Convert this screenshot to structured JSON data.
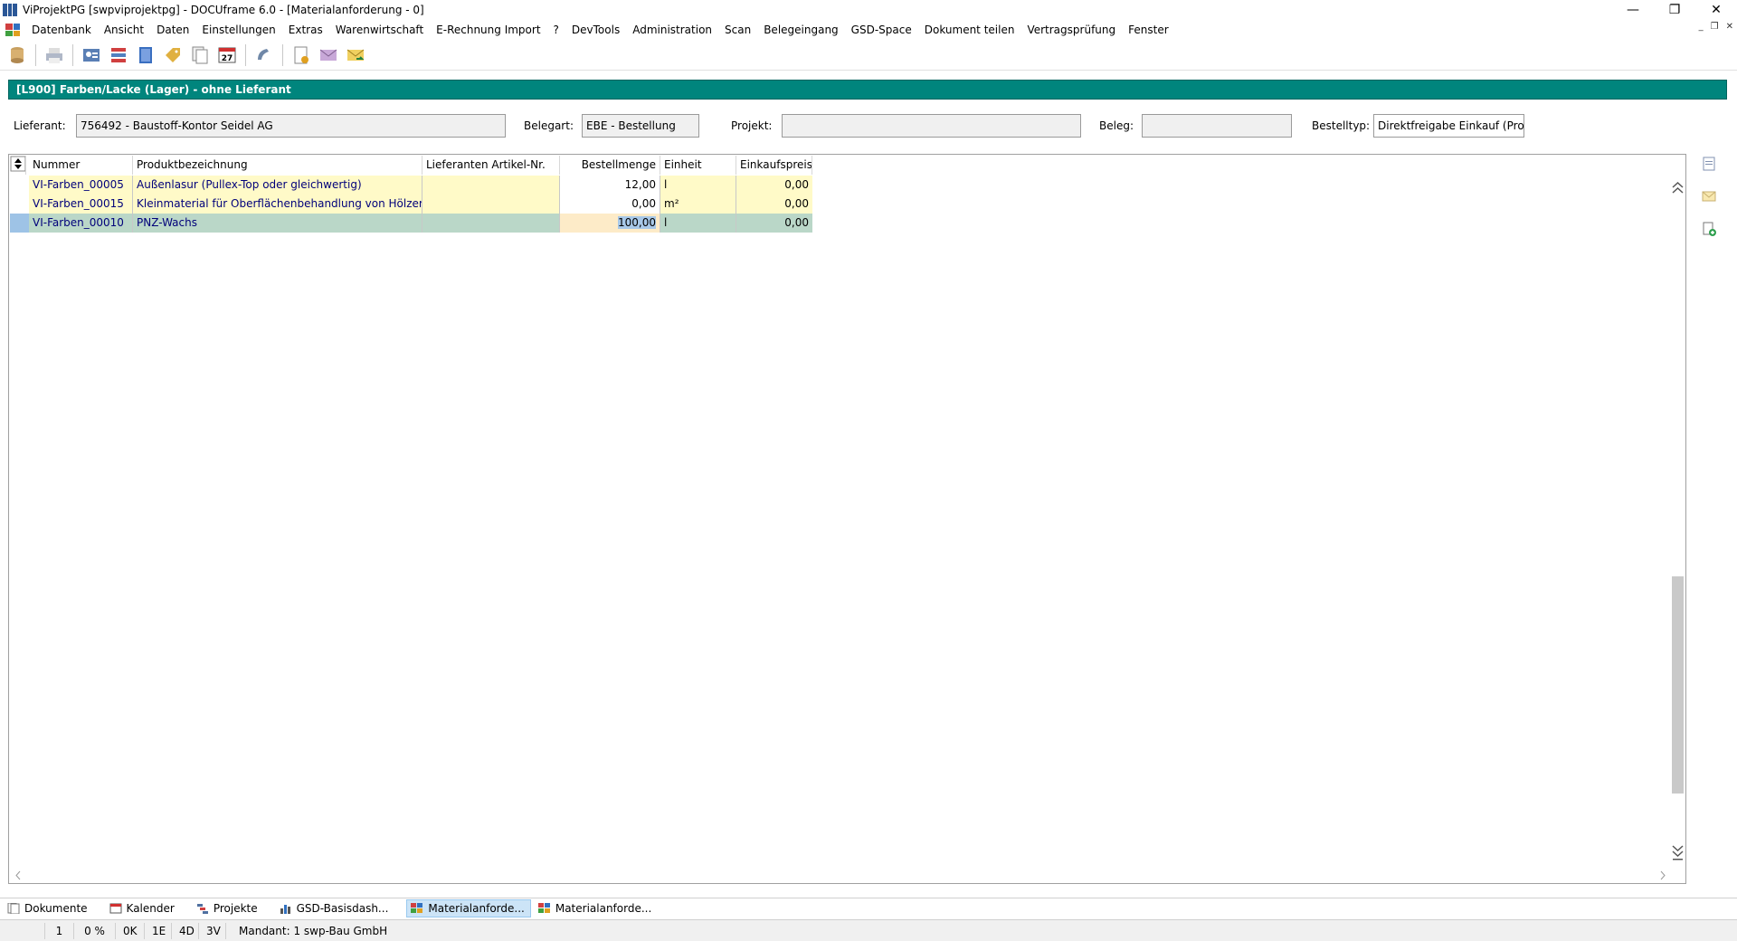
{
  "window": {
    "title": "ViProjektPG [swpviprojektpg] - DOCUframe 6.0 - [Materialanforderung - 0]",
    "minimize": "—",
    "restore": "❐",
    "close": "✕"
  },
  "mdi": {
    "minimize": "_",
    "restore": "❐",
    "close": "✕"
  },
  "menu": [
    "Datenbank",
    "Ansicht",
    "Daten",
    "Einstellungen",
    "Extras",
    "Warenwirtschaft",
    "E-Rechnung Import",
    "?",
    "DevTools",
    "Administration",
    "Scan",
    "Belegeingang",
    "GSD-Space",
    "Dokument teilen",
    "Vertragsprüfung",
    "Fenster"
  ],
  "toolbar_icons": [
    "database-icon",
    "print-icon",
    "contacts-icon",
    "tasks-icon",
    "book-icon",
    "tag-icon",
    "documents-icon",
    "calendar-icon",
    "phone-icon",
    "new-document-icon",
    "mail-icon",
    "mail-forward-icon"
  ],
  "calendar_day": "27",
  "header": {
    "title": "[L900] Farben/Lacke (Lager) - ohne Lieferant"
  },
  "fields": {
    "lieferant_label": "Lieferant:",
    "lieferant_value": "756492 - Baustoff-Kontor Seidel AG",
    "belegart_label": "Belegart:",
    "belegart_value": "EBE - Bestellung",
    "projekt_label": "Projekt:",
    "projekt_value": "",
    "beleg_label": "Beleg:",
    "beleg_value": "",
    "bestelltyp_label": "Bestelltyp:",
    "bestelltyp_value": "Direktfreigabe Einkauf (Projekt"
  },
  "table": {
    "columns": [
      "Nummer",
      "Produktbezeichnung",
      "Lieferanten Artikel-Nr.",
      "Bestellmenge",
      "Einheit",
      "Einkaufspreis"
    ],
    "rows": [
      {
        "nummer": "VI-Farben_00005",
        "bezeichnung": "Außenlasur (Pullex-Top oder gleichwertig)",
        "artikel": "",
        "menge": "12,00",
        "einheit": "l",
        "preis": "0,00"
      },
      {
        "nummer": "VI-Farben_00015",
        "bezeichnung": "Kleinmaterial für Oberflächenbehandlung von Hölzern",
        "artikel": "",
        "menge": "0,00",
        "einheit": "m²",
        "preis": "0,00"
      },
      {
        "nummer": "VI-Farben_00010",
        "bezeichnung": "PNZ-Wachs",
        "artikel": "",
        "menge": "100,00",
        "einheit": "l",
        "preis": "0,00"
      }
    ],
    "selected_row": 2
  },
  "tabs": [
    {
      "label": "Dokumente",
      "icon": "documents-icon",
      "active": false
    },
    {
      "label": "Kalender",
      "icon": "calendar-icon",
      "active": false
    },
    {
      "label": "Projekte",
      "icon": "projects-icon",
      "active": false
    },
    {
      "label": "GSD-Basisdash...",
      "icon": "chart-icon",
      "active": false
    },
    {
      "label": "Materialanforde...",
      "icon": "grid-icon",
      "active": true
    },
    {
      "label": "Materialanforde...",
      "icon": "grid-icon",
      "active": false
    }
  ],
  "status": {
    "page": "1",
    "percent": "0 %",
    "k": "0K",
    "e": "1E",
    "d": "4D",
    "v": "3V",
    "mandant": "Mandant: 1 swp-Bau GmbH"
  },
  "colors": {
    "header_bg": "#00857d",
    "row_yellow": "#fffac8",
    "row_selected": "#bad7c8",
    "link_text": "#00007a"
  }
}
